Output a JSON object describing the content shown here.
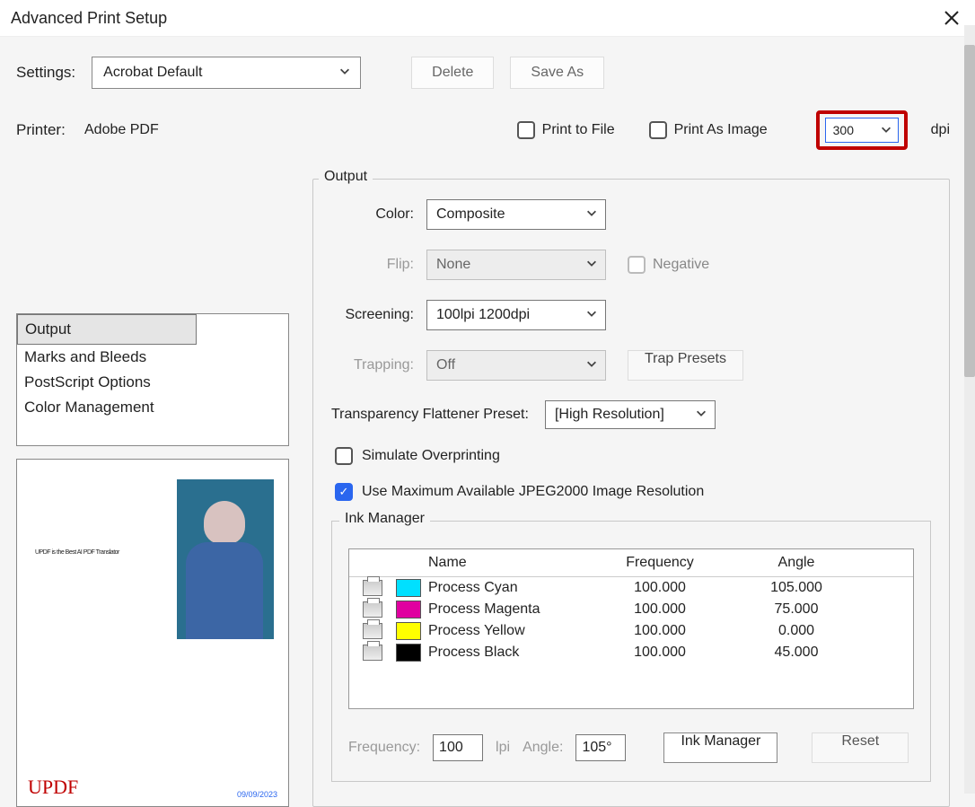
{
  "title": "Advanced Print Setup",
  "settings_label": "Settings:",
  "settings_value": "Acrobat Default",
  "delete_btn": "Delete",
  "saveas_btn": "Save As",
  "printer_label": "Printer:",
  "printer_value": "Adobe PDF",
  "print_to_file": "Print to File",
  "print_as_image": "Print As Image",
  "dpi_value": "300",
  "dpi_label": "dpi",
  "categories": [
    "Output",
    "Marks and Bleeds",
    "PostScript Options",
    "Color Management"
  ],
  "preview": {
    "text_line": "UPDF is the Best AI PDF Translator",
    "brand": "UPDF",
    "date": "09/09/2023"
  },
  "output": {
    "legend": "Output",
    "color_label": "Color:",
    "color_value": "Composite",
    "flip_label": "Flip:",
    "flip_value": "None",
    "negative_label": "Negative",
    "screening_label": "Screening:",
    "screening_value": "100lpi 1200dpi",
    "trapping_label": "Trapping:",
    "trapping_value": "Off",
    "trap_presets_btn": "Trap Presets",
    "flattener_label": "Transparency Flattener Preset:",
    "flattener_value": "[High Resolution]",
    "simulate_label": "Simulate Overprinting",
    "jpeg2000_label": "Use Maximum Available JPEG2000 Image Resolution"
  },
  "inkmanager": {
    "legend": "Ink Manager",
    "hdr_name": "Name",
    "hdr_freq": "Frequency",
    "hdr_angle": "Angle",
    "rows": [
      {
        "name": "Process Cyan",
        "freq": "100.000",
        "angle": "105.000",
        "swatch": "#00e0ff"
      },
      {
        "name": "Process Magenta",
        "freq": "100.000",
        "angle": "75.000",
        "swatch": "#e000a0"
      },
      {
        "name": "Process Yellow",
        "freq": "100.000",
        "angle": "0.000",
        "swatch": "#ffff00"
      },
      {
        "name": "Process Black",
        "freq": "100.000",
        "angle": "45.000",
        "swatch": "#000000"
      }
    ],
    "freq_label": "Frequency:",
    "freq_val": "100",
    "lpi": "lpi",
    "angle_label": "Angle:",
    "angle_val": "105°",
    "inkmgr_btn": "Ink Manager",
    "reset_btn": "Reset"
  }
}
